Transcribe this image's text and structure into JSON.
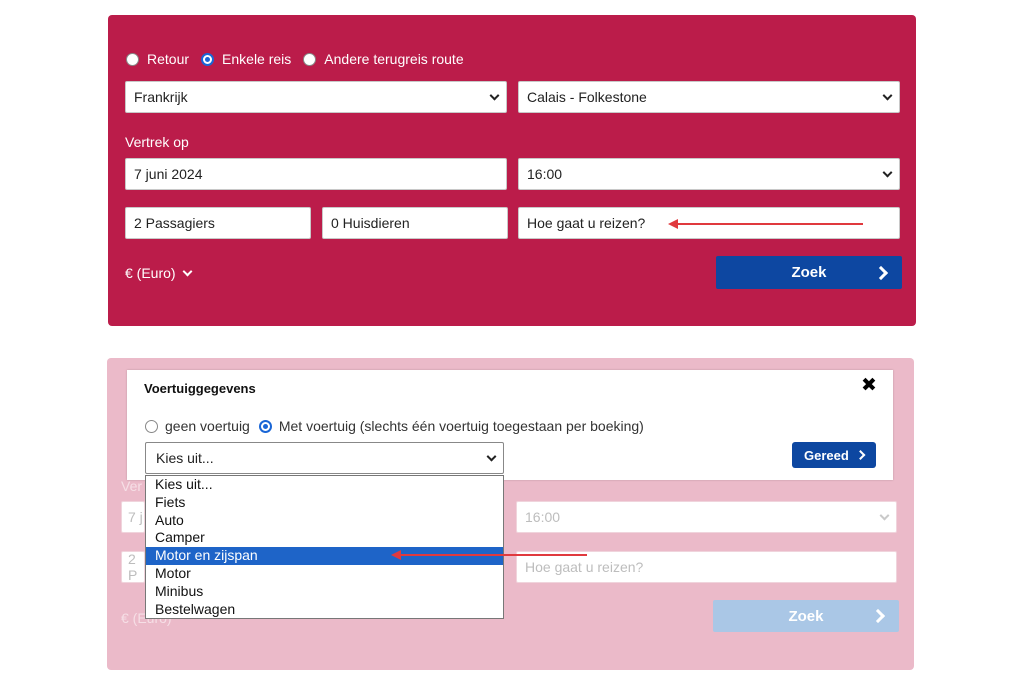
{
  "booking_form": {
    "trip_options": [
      "Retour",
      "Enkele reis",
      "Andere terugreis route"
    ],
    "selected_trip": "Enkele reis",
    "country": "Frankrijk",
    "route": "Calais - Folkestone",
    "departure_label": "Vertrek op",
    "date": "7 juni 2024",
    "time": "16:00",
    "passengers": "2 Passagiers",
    "pets": "0 Huisdieren",
    "travel_mode_placeholder": "Hoe gaat u reizen?",
    "currency": "€ (Euro)",
    "search_label": "Zoek"
  },
  "background_form": {
    "date_partial": "7 j",
    "time": "16:00",
    "passengers_partial": "2 P",
    "travel_mode_placeholder": "Hoe gaat u reizen?",
    "currency": "€ (Euro)",
    "search_label": "Zoek",
    "departure_partial": "Ver"
  },
  "vehicle_modal": {
    "title": "Voertuiggegevens",
    "close_symbol": "✖",
    "options": [
      "geen voertuig",
      "Met voertuig (slechts één voertuig toegestaan per boeking)"
    ],
    "selected_option": "Met voertuig (slechts één voertuig toegestaan per boeking)",
    "select_value": "Kies uit...",
    "done_label": "Gereed",
    "dropdown_items": [
      "Kies uit...",
      "Fiets",
      "Auto",
      "Camper",
      "Motor en zijspan",
      "Motor",
      "Minibus",
      "Bestelwagen"
    ],
    "highlighted_item": "Motor en zijspan"
  },
  "colors": {
    "brand_red": "#bb1c4a",
    "brand_blue": "#0d47a1",
    "annotation_arrow": "#e0393e",
    "faded_panel": "#ebbac9"
  }
}
